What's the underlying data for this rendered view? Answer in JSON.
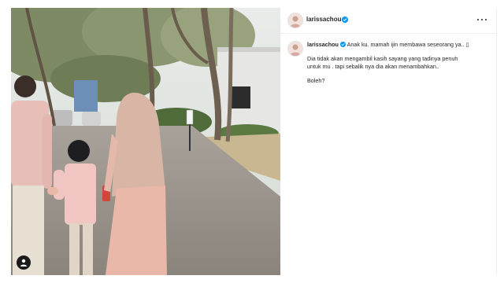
{
  "post": {
    "username": "larissachou",
    "caption": {
      "first_line": "Anak ku. mamah ijin membawa seseorang ya..",
      "emoji_box": "▯",
      "paragraph_line1": "Dia tidak akan mengambil kasih sayang yang tadinya penuh",
      "paragraph_line2": "untuk mu . tapi sebalik nya dia akan menambahkan..",
      "closing": "Boleh?"
    }
  },
  "icons": {
    "verified": "verified-badge-icon",
    "more": "more-options-icon",
    "tag": "user-tag-icon"
  },
  "colors": {
    "verified_blue": "#0095f6",
    "text": "#262626",
    "divider": "#efefef"
  }
}
